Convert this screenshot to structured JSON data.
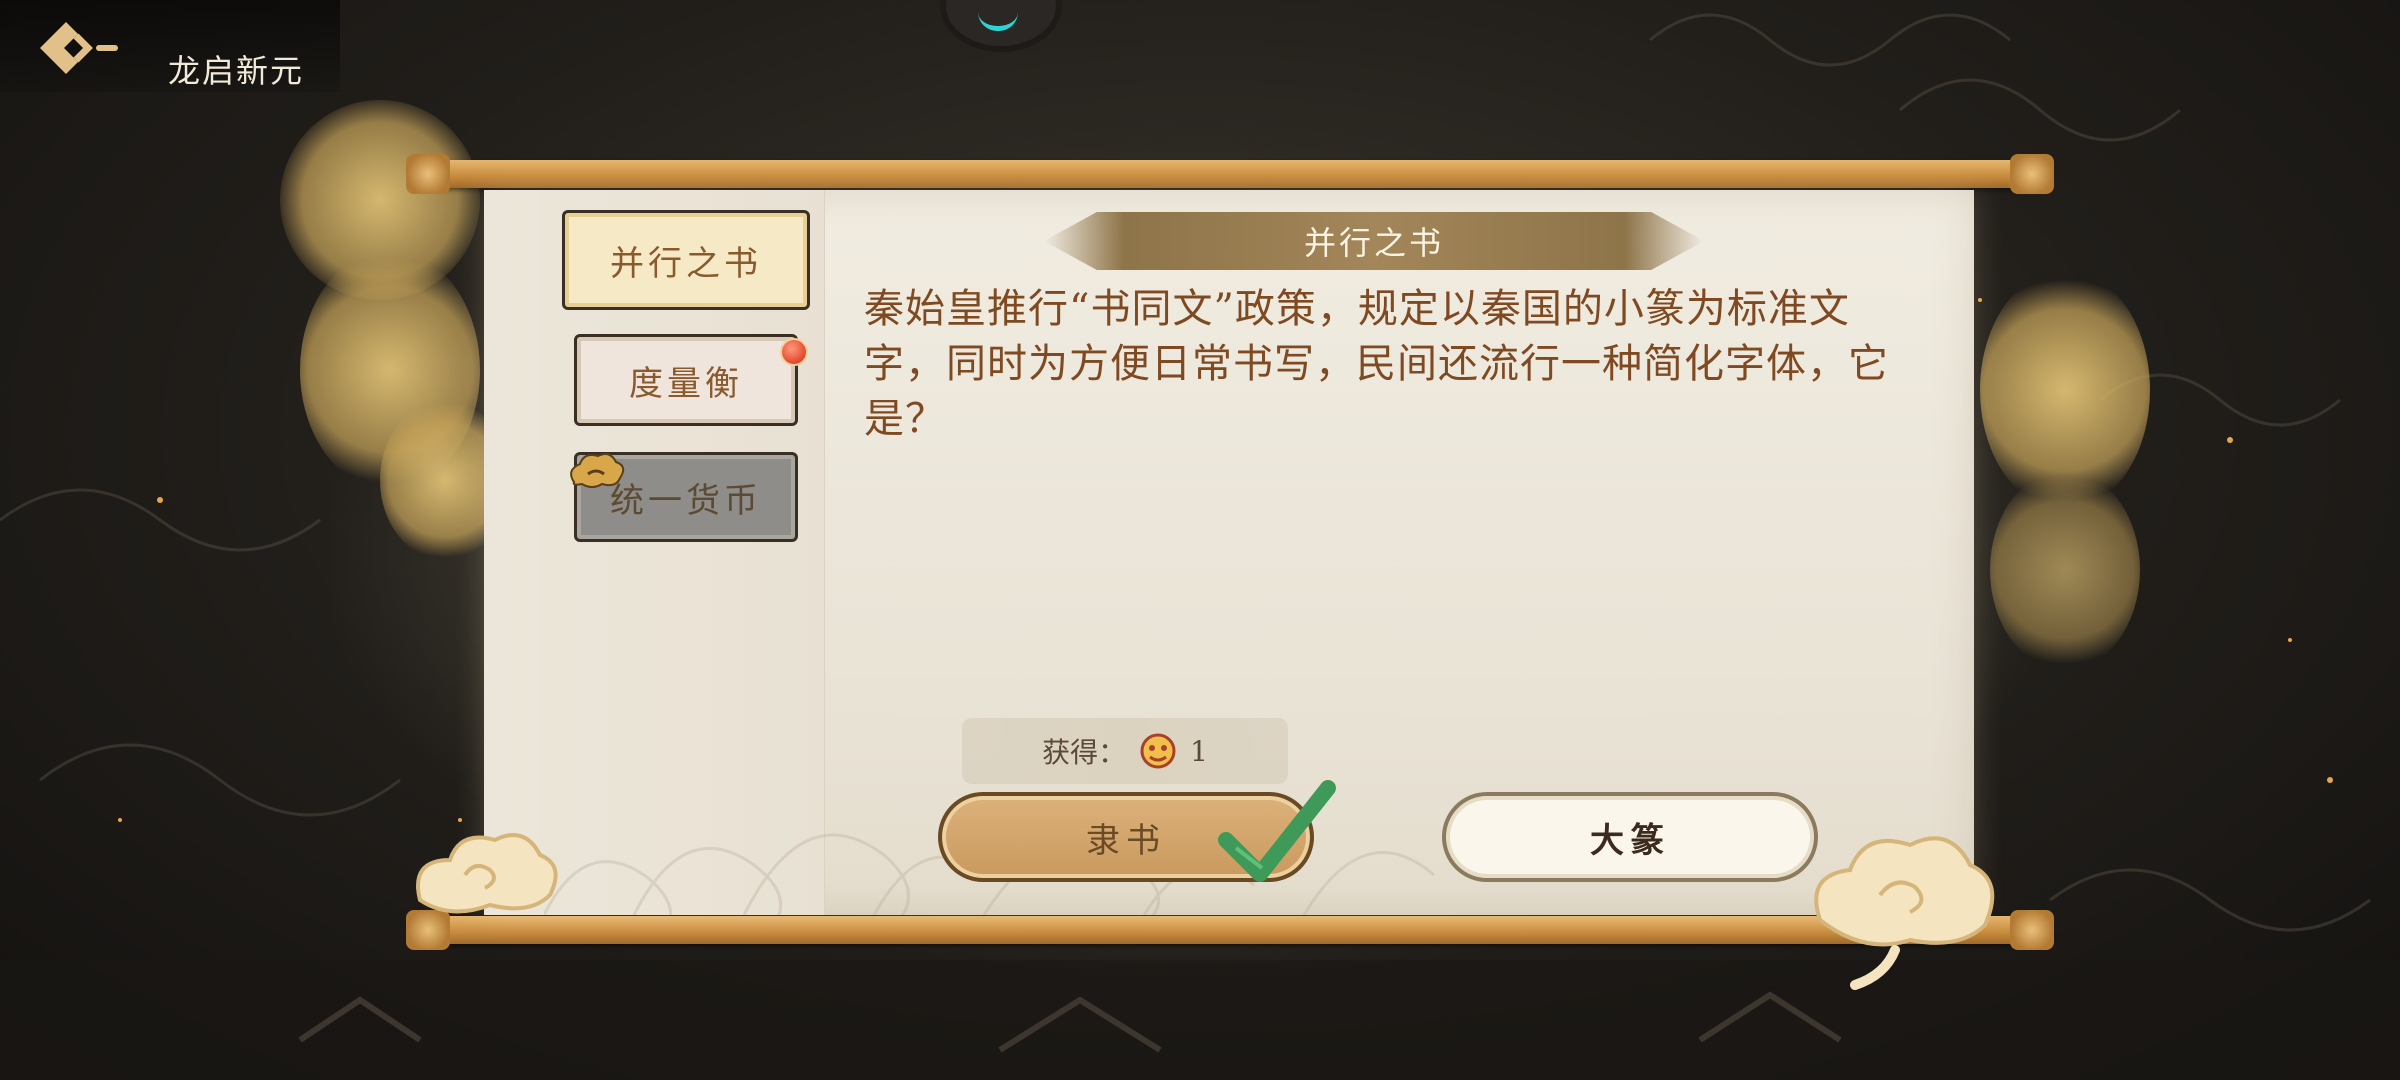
{
  "header": {
    "title": "龙启新元",
    "back_icon": "back-arrow-icon"
  },
  "sidebar": {
    "tabs": [
      {
        "label": "并行之书",
        "state": "selected"
      },
      {
        "label": "度量衡",
        "state": "normal",
        "has_notification": true
      },
      {
        "label": "统一货币",
        "state": "locked"
      }
    ]
  },
  "quiz": {
    "banner_title": "并行之书",
    "question": "秦始皇推行“书同文”政策，规定以秦国的小篆为标准文字，同时为方便日常书写，民间还流行一种简化字体，它是？",
    "reward_label": "获得：",
    "reward_count": "1",
    "reward_icon": "lion-dance-token-icon",
    "answers": [
      {
        "label": "隶书",
        "correct": true
      },
      {
        "label": "大篆",
        "correct": false
      }
    ]
  },
  "colors": {
    "accent_gold": "#c99a5f",
    "question_text": "#7f4a22",
    "correct_check": "#3f9a5a",
    "notification_dot": "#e2472c"
  }
}
